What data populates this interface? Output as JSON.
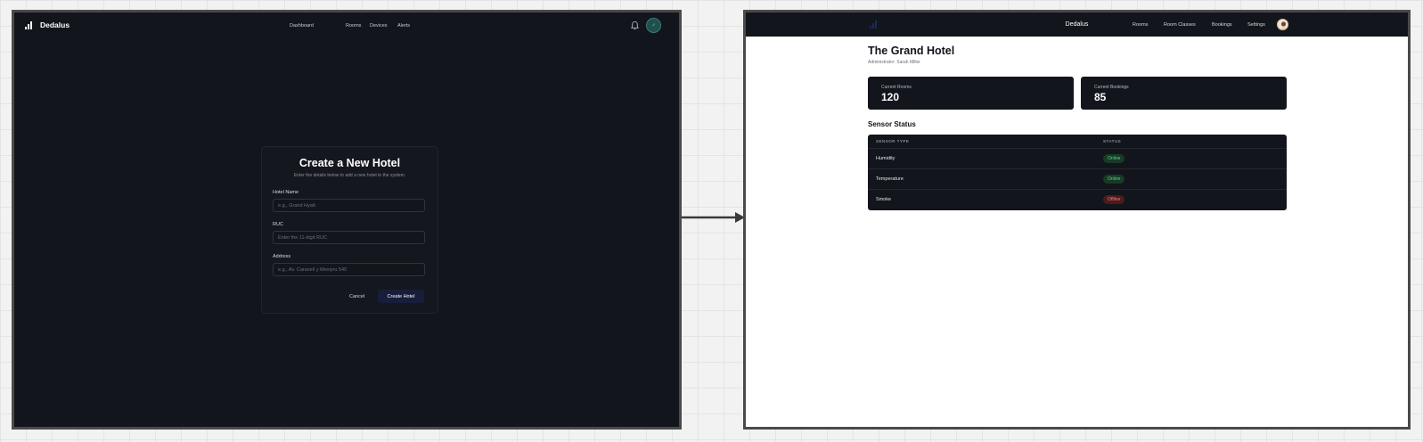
{
  "left_screen": {
    "brand": "Dedalus",
    "nav": [
      "Dashboard",
      "Rooms",
      "Devices",
      "Alerts"
    ],
    "modal": {
      "title": "Create a New Hotel",
      "subtitle": "Enter the details below to add a new hotel to the system.",
      "fields": [
        {
          "label": "Hotel Name",
          "placeholder": "e.g., Grand Hyatt"
        },
        {
          "label": "RUC",
          "placeholder": "Enter the 11-digit RUC"
        },
        {
          "label": "Address",
          "placeholder": "e.g., Av. Caravelí y Mexiyru 540"
        }
      ],
      "cancel_label": "Cancel",
      "submit_label": "Create Hotel"
    }
  },
  "right_screen": {
    "brand": "Dedalus",
    "nav": [
      "Rooms",
      "Room Classes",
      "Bookings",
      "Settings"
    ],
    "hotel_name": "The Grand Hotel",
    "administrator": "Administrator: Sarah Miller",
    "stats": [
      {
        "label": "Current Rooms",
        "value": "120"
      },
      {
        "label": "Current Bookings",
        "value": "85"
      }
    ],
    "sensor_section_title": "Sensor Status",
    "sensor_table": {
      "headers": [
        "SENSOR TYPE",
        "STATUS"
      ],
      "rows": [
        {
          "type": "Humidity",
          "status": "Online"
        },
        {
          "type": "Temperature",
          "status": "Online"
        },
        {
          "type": "Smoke",
          "status": "Offline"
        }
      ]
    }
  },
  "colors": {
    "dark_bg": "#13151c",
    "online": "#5fd38a",
    "offline": "#ff7b7b",
    "primary_button": "#181d3a"
  }
}
